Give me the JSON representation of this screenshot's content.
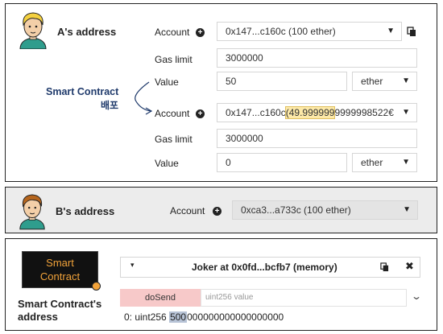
{
  "panel_a": {
    "title": "A's address",
    "account_label": "Account",
    "account_value": "0x147...c160c (100 ether)",
    "gas_limit_label": "Gas limit",
    "gas_limit_value": "3000000",
    "value_label": "Value",
    "value_amount": "50",
    "value_unit": "ether",
    "deploy_note_line1": "Smart Contract",
    "deploy_note_line2": "배포",
    "account2_label": "Account",
    "account2_prefix": "0x147...c160c",
    "account2_balance_highlight": "(49.999999",
    "account2_balance_rest": "9999998522€",
    "gas_limit2_label": "Gas limit",
    "gas_limit2_value": "3000000",
    "value2_label": "Value",
    "value2_amount": "0",
    "value2_unit": "ether"
  },
  "panel_b": {
    "title": "B's address",
    "account_label": "Account",
    "account_value": "0xca3...a733c (100 ether)"
  },
  "panel_c": {
    "badge_line1": "Smart",
    "badge_line2": "Contract",
    "title_line1": "Smart Contract's",
    "title_line2": "address",
    "instance_title": "Joker at 0x0fd...bcfb7 (memory)",
    "function_button": "doSend",
    "function_placeholder": "uint256 value",
    "output_prefix": "0: uint256",
    "output_highlight": "500",
    "output_rest": "000000000000000000"
  },
  "colors": {
    "highlight_yellow": "#fde9a8",
    "do_send_pink": "#f7c9c9",
    "badge_bg": "#111111",
    "badge_text": "#f2a33a",
    "navy": "#1f3a6b"
  }
}
